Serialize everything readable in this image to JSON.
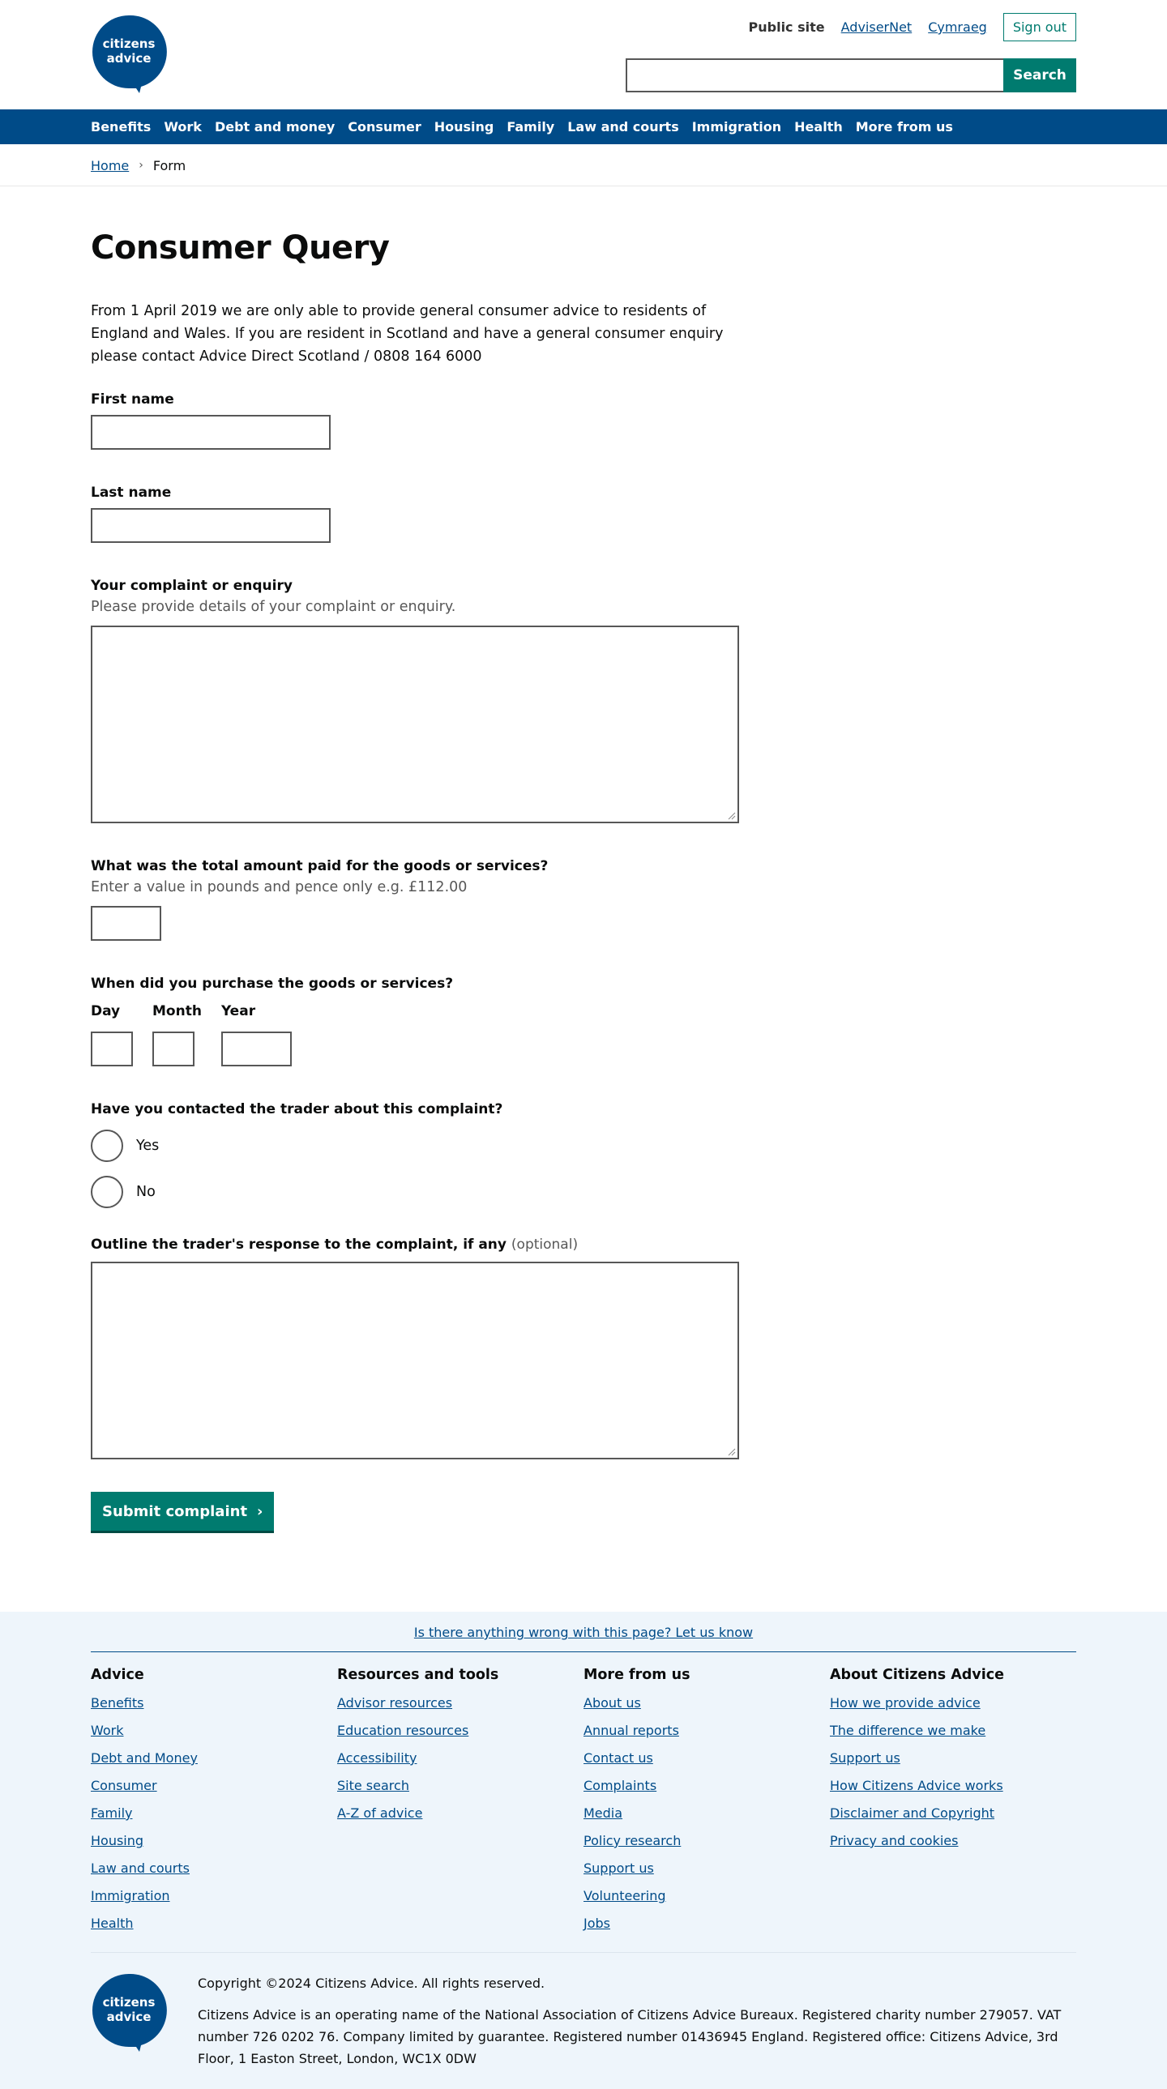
{
  "logo": {
    "line1": "citizens",
    "line2": "advice"
  },
  "header": {
    "public_site": "Public site",
    "links": [
      "AdviserNet",
      "Cymraeg"
    ],
    "sign_out": "Sign out",
    "search_button": "Search",
    "search_placeholder": ""
  },
  "nav": [
    "Benefits",
    "Work",
    "Debt and money",
    "Consumer",
    "Housing",
    "Family",
    "Law and courts",
    "Immigration",
    "Health",
    "More from us"
  ],
  "breadcrumb": {
    "home": "Home",
    "separator": "›",
    "current": "Form"
  },
  "page": {
    "title": "Consumer Query",
    "intro": "From 1 April 2019 we are only able to provide general consumer advice to residents of England and Wales. If you are resident in Scotland and have a general consumer enquiry please contact Advice Direct Scotland / 0808 164 6000"
  },
  "form": {
    "first_name": {
      "label": "First name",
      "value": ""
    },
    "last_name": {
      "label": "Last name",
      "value": ""
    },
    "complaint": {
      "label": "Your complaint or enquiry",
      "hint": "Please provide details of your complaint or enquiry.",
      "value": ""
    },
    "amount": {
      "label": "What was the total amount paid for the goods or services?",
      "hint": "Enter a value in pounds and pence only e.g. £112.00",
      "value": ""
    },
    "purchase_date": {
      "label": "When did you purchase the goods or services?",
      "day": "Day",
      "month": "Month",
      "year": "Year"
    },
    "contacted": {
      "label": "Have you contacted the trader about this complaint?",
      "yes": "Yes",
      "no": "No",
      "selected": ""
    },
    "response": {
      "label": "Outline the trader's response to the complaint, if any",
      "optional": "(optional)",
      "value": ""
    },
    "submit": "Submit complaint"
  },
  "footer": {
    "feedback": "Is there anything wrong with this page? Let us know",
    "columns": [
      {
        "title": "Advice",
        "links": [
          "Benefits",
          "Work",
          "Debt and Money",
          "Consumer",
          "Family",
          "Housing",
          "Law and courts",
          "Immigration",
          "Health"
        ]
      },
      {
        "title": "Resources and tools",
        "links": [
          "Advisor resources",
          "Education resources",
          "Accessibility",
          "Site search",
          "A-Z of advice"
        ]
      },
      {
        "title": "More from us",
        "links": [
          "About us",
          "Annual reports",
          "Contact us",
          "Complaints",
          "Media",
          "Policy research",
          "Support us",
          "Volunteering",
          "Jobs"
        ]
      },
      {
        "title": "About Citizens Advice",
        "links": [
          "How we provide advice",
          "The difference we make",
          "Support us",
          "How Citizens Advice works",
          "Disclaimer and Copyright",
          "Privacy and cookies"
        ]
      }
    ],
    "copyright": "Copyright ©2024 Citizens Advice. All rights reserved.",
    "legal": "Citizens Advice is an operating name of the National Association of Citizens Advice Bureaux. Registered charity number 279057. VAT number 726 0202 76. Company limited by guarantee. Registered number 01436945 England. Registered office: Citizens Advice, 3rd Floor, 1 Easton Street, London, WC1X 0DW"
  },
  "colors": {
    "brand_blue": "#004b88",
    "accent_green": "#007b6f",
    "footer_bg": "#eef5fb"
  }
}
